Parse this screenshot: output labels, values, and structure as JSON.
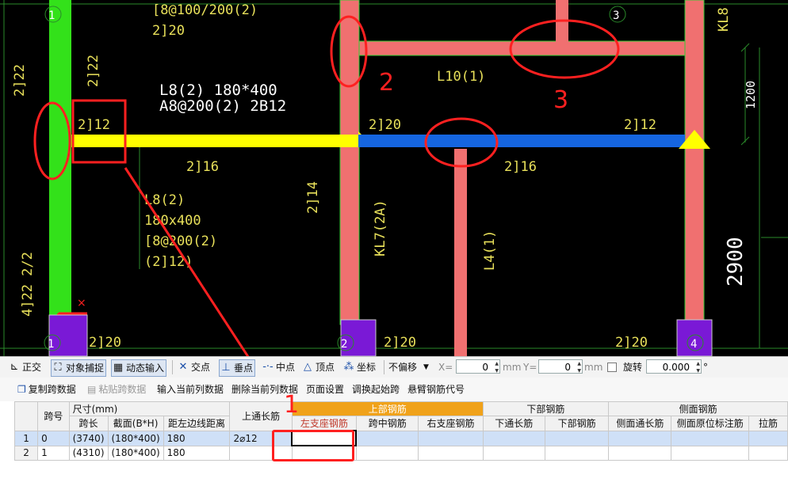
{
  "drawing": {
    "axis_labels": [
      "1",
      "2",
      "3",
      "4"
    ],
    "beam_labels": {
      "l8_top_line1": "L8(2) 180*400",
      "l8_top_line2": "A8@200(2) 2B12",
      "l8_side": [
        "L8(2)",
        "180x400",
        "[8@200(2)",
        "(2]12)"
      ],
      "l10": "L10(1)",
      "kl7": "KL7(2A)",
      "l4": "L4(1)",
      "kl8": "KL8"
    },
    "rebar_labels": {
      "top_left_stirrup": "[8@100/200(2)",
      "top_left_220": "2]20",
      "col_222": "2]22",
      "col_222b": "2]22",
      "left_212": "2]12",
      "mid_216": "2]16",
      "right_216": "2]16",
      "mid_220": "2]20",
      "right_212": "2]12",
      "side_214": "2]14",
      "left_422": "4]22 2/2",
      "bottom_220a": "2]20",
      "bottom_220b": "2]20",
      "bottom_220c": "2]20"
    },
    "dimensions": {
      "d1200": "1200",
      "d2900": "2900"
    },
    "annotations": {
      "n2": "2",
      "n3": "3",
      "n1": "1",
      "cursor_x": "×"
    }
  },
  "snapbar": {
    "items": [
      {
        "label": "正交",
        "icon": "orthogonal-icon"
      },
      {
        "label": "对象捕捉",
        "icon": "object-snap-icon"
      },
      {
        "label": "动态输入",
        "icon": "dynamic-input-icon"
      },
      {
        "label": "交点",
        "icon": "intersection-icon"
      },
      {
        "label": "垂点",
        "icon": "perpendicular-icon"
      },
      {
        "label": "中点",
        "icon": "midpoint-icon"
      },
      {
        "label": "顶点",
        "icon": "vertex-icon"
      },
      {
        "label": "坐标",
        "icon": "coordinate-icon"
      }
    ],
    "offset_select": "不偏移",
    "x_label": "X=",
    "x_value": "0",
    "y_label": "Y=",
    "y_value": "0",
    "mm": "mm",
    "rotate_label": "旋转",
    "rotate_value": "0.000",
    "degree": "°"
  },
  "toolbar2": {
    "copy": "复制跨数据",
    "paste": "粘贴跨数据",
    "input_current": "输入当前列数据",
    "delete_current": "删除当前列数据",
    "page_setup": "页面设置",
    "swap_start": "调换起始跨",
    "cantilever": "悬臂钢筋代号"
  },
  "table": {
    "h_span_no": "跨号",
    "h_size_group": "尺寸(mm)",
    "h_span_len": "跨长",
    "h_section": "截面(B*H)",
    "h_dist_left": "距左边线距离",
    "h_top_through": "上通长筋",
    "h_top_group": "上部钢筋",
    "h_left_support": "左支座钢筋",
    "h_mid_span": "跨中钢筋",
    "h_right_support": "右支座钢筋",
    "h_bottom_group": "下部钢筋",
    "h_bottom_through": "下通长筋",
    "h_bottom_bar": "下部钢筋",
    "h_side_group": "侧面钢筋",
    "h_side_through": "侧面通长筋",
    "h_side_orig": "侧面原位标注筋",
    "h_tie": "拉筋",
    "rows": [
      {
        "idx": "1",
        "span": "0",
        "len": "(3740)",
        "sec": "(180*400)",
        "dist": "180",
        "top": "2⌀12"
      },
      {
        "idx": "2",
        "span": "1",
        "len": "(4310)",
        "sec": "(180*400)",
        "dist": "180",
        "top": ""
      }
    ]
  },
  "colors": {
    "beam_pink": "#f07070",
    "beam_yellow": "#ffff00",
    "beam_blue": "#1565e0",
    "column_green": "#33e11a",
    "column_purple": "#7a19d6",
    "annotation_red": "#ff2020",
    "header_orange": "#f0a21a"
  }
}
